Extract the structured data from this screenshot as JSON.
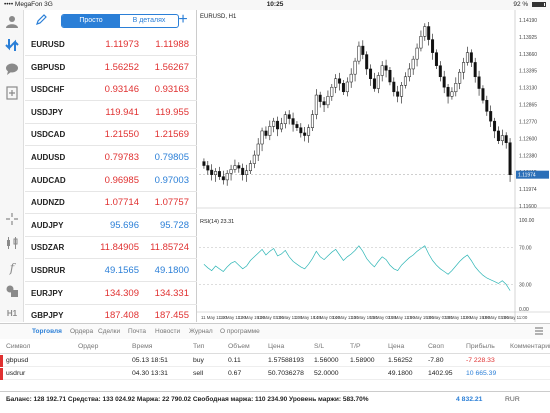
{
  "status_bar": {
    "carrier": "•••• MegaFon  3G",
    "time": "10:25",
    "battery": "92 %",
    "battery_level": 0.92
  },
  "quotes": {
    "segment": {
      "simple": "Просто",
      "detailed": "В деталях"
    },
    "rows": [
      {
        "symbol": "EURUSD",
        "bid": "1.11973",
        "ask": "1.11988",
        "dir": "down"
      },
      {
        "symbol": "GBPUSD",
        "bid": "1.56252",
        "ask": "1.56267",
        "dir": "down"
      },
      {
        "symbol": "USDCHF",
        "bid": "0.93146",
        "ask": "0.93163",
        "dir": "down"
      },
      {
        "symbol": "USDJPY",
        "bid": "119.941",
        "ask": "119.955",
        "dir": "down"
      },
      {
        "symbol": "USDCAD",
        "bid": "1.21550",
        "ask": "1.21569",
        "dir": "down"
      },
      {
        "symbol": "AUDUSD",
        "bid": "0.79783",
        "ask": "0.79805",
        "dir": "mixed"
      },
      {
        "symbol": "AUDCAD",
        "bid": "0.96985",
        "ask": "0.97003",
        "dir": "mixed"
      },
      {
        "symbol": "AUDNZD",
        "bid": "1.07714",
        "ask": "1.07757",
        "dir": "down"
      },
      {
        "symbol": "AUDJPY",
        "bid": "95.696",
        "ask": "95.728",
        "dir": "up"
      },
      {
        "symbol": "USDZAR",
        "bid": "11.84905",
        "ask": "11.85724",
        "dir": "down"
      },
      {
        "symbol": "USDRUR",
        "bid": "49.1565",
        "ask": "49.1800",
        "dir": "up"
      },
      {
        "symbol": "EURJPY",
        "bid": "134.309",
        "ask": "134.331",
        "dir": "down"
      },
      {
        "symbol": "GBPJPY",
        "bid": "187.408",
        "ask": "187.455",
        "dir": "down"
      }
    ]
  },
  "chart": {
    "title": "EURUSD, H1",
    "price_labels": [
      "1.14190",
      "1.13925",
      "1.13660",
      "1.13395",
      "1.13130",
      "1.12865",
      "1.12770",
      "1.12600",
      "1.12380",
      "1.12115",
      "1.11974",
      "1.11600"
    ],
    "current_price": "1.11974",
    "rsi_title": "RSI(14) 23.31",
    "rsi_levels": [
      "100.00",
      "70.00",
      "30.00",
      "0.00"
    ],
    "time_labels": [
      "11 May 11:00",
      "12 May 11:00",
      "12 May 19:00",
      "13 May 03:00",
      "13 May 11:00",
      "13 May 19:00",
      "14 May 03:00",
      "14 May 11:00",
      "14 May 19:00",
      "15 May 03:00",
      "15 May 11:00",
      "15 May 19:00",
      "18 May 03:00",
      "18 May 11:00",
      "18 May 19:00",
      "19 May 03:00",
      "19 May 11:00"
    ],
    "accent": "#2b7fd7"
  },
  "chart_data": {
    "type": "candlestick",
    "title": "EURUSD, H1",
    "ylim": [
      1.115,
      1.1435
    ],
    "closes": [
      1.1212,
      1.1205,
      1.1198,
      1.1203,
      1.1195,
      1.119,
      1.12,
      1.1206,
      1.1212,
      1.1208,
      1.1198,
      1.1204,
      1.1215,
      1.1228,
      1.1245,
      1.1265,
      1.1258,
      1.1272,
      1.128,
      1.1268,
      1.1276,
      1.129,
      1.1284,
      1.1275,
      1.127,
      1.1262,
      1.1258,
      1.127,
      1.129,
      1.132,
      1.131,
      1.1305,
      1.1318,
      1.1332,
      1.1345,
      1.1338,
      1.1325,
      1.134,
      1.1352,
      1.1372,
      1.1395,
      1.1382,
      1.136,
      1.1345,
      1.133,
      1.135,
      1.1365,
      1.1358,
      1.134,
      1.1325,
      1.1318,
      1.1335,
      1.1348,
      1.136,
      1.1375,
      1.1392,
      1.141,
      1.1425,
      1.1405,
      1.1385,
      1.1365,
      1.1348,
      1.1332,
      1.1318,
      1.1325,
      1.1338,
      1.1355,
      1.137,
      1.1385,
      1.137,
      1.1348,
      1.133,
      1.1312,
      1.1295,
      1.128,
      1.1265,
      1.125,
      1.1258,
      1.1247,
      1.1198
    ],
    "rsi": [
      52,
      48,
      45,
      50,
      47,
      44,
      49,
      53,
      55,
      51,
      47,
      50,
      56,
      60,
      64,
      68,
      62,
      66,
      69,
      61,
      63,
      67,
      60,
      55,
      52,
      49,
      47,
      52,
      58,
      66,
      60,
      57,
      61,
      65,
      68,
      62,
      56,
      60,
      63,
      67,
      72,
      66,
      58,
      53,
      49,
      55,
      60,
      57,
      51,
      47,
      45,
      51,
      55,
      59,
      62,
      66,
      69,
      72,
      63,
      56,
      51,
      47,
      44,
      41,
      45,
      50,
      55,
      59,
      62,
      56,
      49,
      44,
      40,
      37,
      35,
      33,
      31,
      34,
      30,
      23.31
    ]
  },
  "bottom_tabs": {
    "h1": "H1",
    "items": [
      "Торговля",
      "Ордера",
      "Сделки",
      "Почта",
      "Новости",
      "Журнал",
      "О программе"
    ],
    "active": 0
  },
  "positions": {
    "headers": [
      "Символ",
      "Ордер",
      "Время",
      "Тип",
      "Объем",
      "Цена",
      "S/L",
      "T/P",
      "Цена",
      "Своп",
      "Прибыль",
      "Комментарий"
    ],
    "rows": [
      {
        "symbol": "gbpusd",
        "order": "",
        "time": "05.13 18:51",
        "type": "buy",
        "volume": "0.11",
        "price": "1.57588193",
        "sl": "1.56000",
        "tp": "1.58900",
        "cur": "1.56252",
        "swap": "-7.80",
        "profit": "-7 228.33",
        "profit_sign": "neg",
        "comment": ""
      },
      {
        "symbol": "usdrur",
        "order": "",
        "time": "04.30 13:31",
        "type": "sell",
        "volume": "0.67",
        "price": "50.7036278",
        "sl": "52.0000",
        "tp": "",
        "cur": "49.1800",
        "swap": "1402.95",
        "profit": "10 665.39",
        "profit_sign": "pos",
        "comment": ""
      }
    ]
  },
  "footer": {
    "summary": "Баланс: 128 192.71 Средства: 133 024.92 Маржа: 22 790.02 Свободная маржа: 110 234.90 Уровень маржи: 583.70%",
    "balance": "4 832.21",
    "currency": "RUR"
  }
}
